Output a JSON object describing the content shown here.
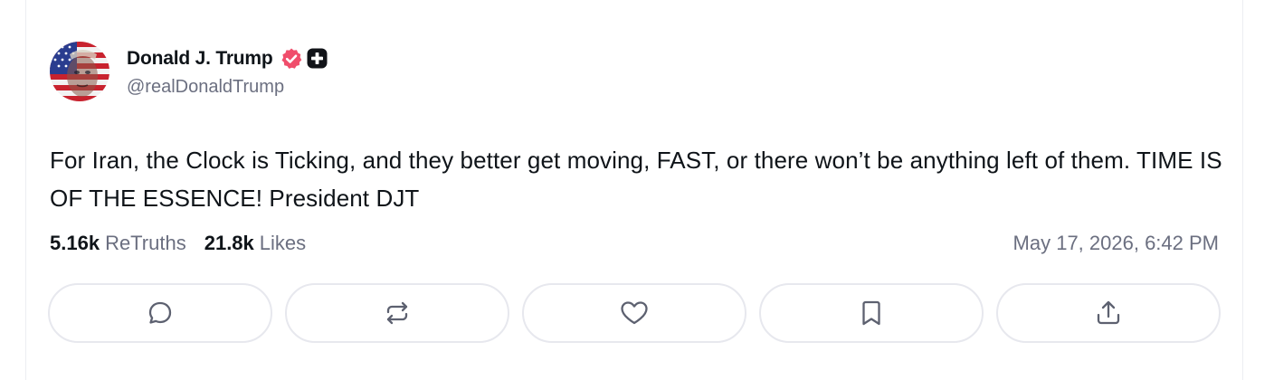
{
  "post": {
    "author": {
      "display_name": "Donald J. Trump",
      "handle": "@realDonaldTrump",
      "verified": true,
      "avatar_icon": "avatar-flag-portrait"
    },
    "text": "For Iran, the Clock is Ticking, and they better get moving, FAST, or there won’t be anything left of them. TIME IS OF THE ESSENCE! President DJT",
    "stats": {
      "retruths_count": "5.16k",
      "retruths_label": "ReTruths",
      "likes_count": "21.8k",
      "likes_label": "Likes"
    },
    "timestamp": "May 17, 2026, 6:42 PM"
  },
  "actions": [
    {
      "name": "reply",
      "icon": "reply-icon"
    },
    {
      "name": "retruth",
      "icon": "retruth-icon"
    },
    {
      "name": "like",
      "icon": "heart-icon"
    },
    {
      "name": "bookmark",
      "icon": "bookmark-icon"
    },
    {
      "name": "share",
      "icon": "share-icon"
    }
  ],
  "colors": {
    "text_primary": "#0f1419",
    "text_secondary": "#6b6f80",
    "verified_badge": "#f04d6b",
    "button_border": "#e7e8ee",
    "icon": "#5d6170"
  }
}
